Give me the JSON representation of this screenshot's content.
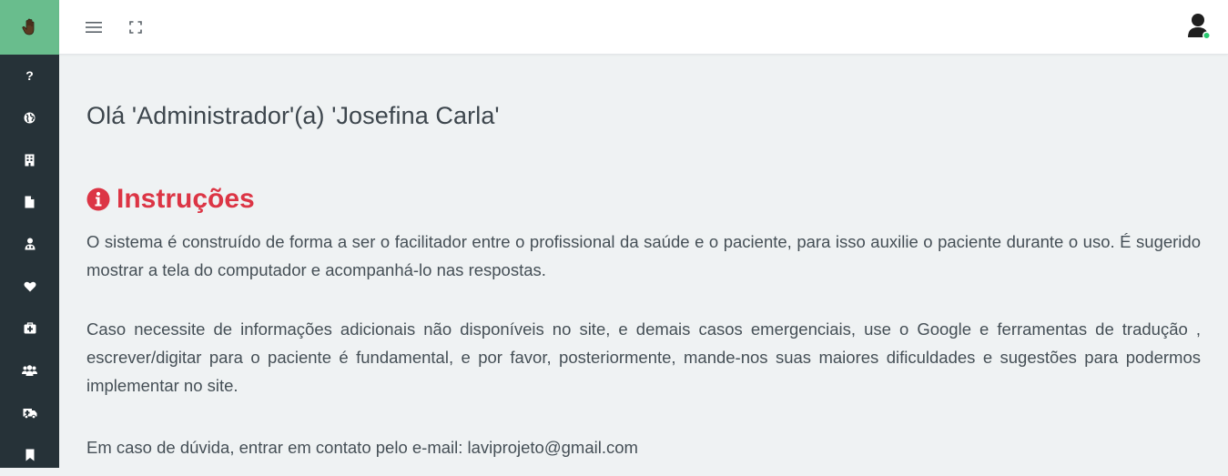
{
  "sidebar": {
    "brand_icon": "hand-icon",
    "items": [
      {
        "icon": "question-icon",
        "glyph": "?"
      },
      {
        "icon": "globe-icon"
      },
      {
        "icon": "building-icon"
      },
      {
        "icon": "file-icon"
      },
      {
        "icon": "user-doctor-icon"
      },
      {
        "icon": "heart-icon"
      },
      {
        "icon": "medkit-icon"
      },
      {
        "icon": "users-icon"
      },
      {
        "icon": "ambulance-icon"
      },
      {
        "icon": "bookmark-icon"
      }
    ]
  },
  "topbar": {
    "menu_icon": "hamburger-icon",
    "fullscreen_icon": "fullscreen-icon",
    "user_icon": "user-icon",
    "status_color": "#28c76f"
  },
  "main": {
    "greeting": "Olá 'Administrador'(a) 'Josefina Carla'",
    "instructions_title": "Instruções",
    "paragraph_1": "O sistema é construído de forma a ser o facilitador entre o profissional da saúde e o paciente, para isso auxilie o paciente durante o uso. É sugerido mostrar a tela do computador e acompanhá-lo nas respostas.",
    "paragraph_2": "Caso necessite de informações adicionais não disponíveis no site, e demais casos emergenciais, use o Google e ferramentas de tradução , escrever/digitar para o paciente é fundamental, e por favor, posteriormente, mande-nos suas maiores dificuldades e sugestões para podermos implementar no site.",
    "paragraph_3": "Em caso de dúvida, entrar em contato pelo e-mail: laviprojeto@gmail.com"
  },
  "colors": {
    "sidebar_bg": "#263238",
    "brand_bg": "#69bd8d",
    "title_red": "#dc3545",
    "content_bg": "#eff2f3"
  }
}
